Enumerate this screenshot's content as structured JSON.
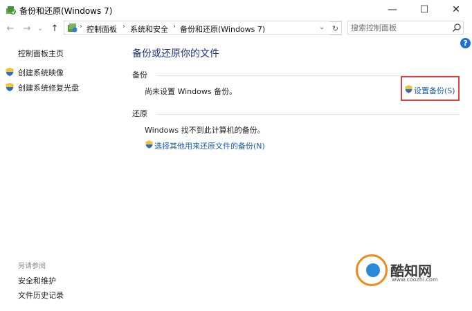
{
  "window": {
    "title": "备份和还原(Windows 7)",
    "minimize_symbol": "—",
    "maximize_symbol": "☐",
    "close_symbol": "✕"
  },
  "nav": {
    "back_symbol": "←",
    "forward_symbol": "→",
    "recent_symbol": "⌄",
    "up_symbol": "↑",
    "breadcrumb": [
      "控制面板",
      "系统和安全",
      "备份和还原(Windows 7)"
    ],
    "breadcrumb_separator": "›",
    "dropdown_symbol": "⌄",
    "refresh_symbol": "↻"
  },
  "search": {
    "placeholder": "搜索控制面板"
  },
  "help": {
    "symbol": "?"
  },
  "sidebar": {
    "home": "控制面板主页",
    "items": [
      {
        "label": "创建系统映像",
        "icon": "shield-icon"
      },
      {
        "label": "创建系统修复光盘",
        "icon": "shield-icon"
      }
    ],
    "see_also_heading": "另请参阅",
    "see_also": [
      "安全和维护",
      "文件历史记录"
    ]
  },
  "main": {
    "title": "备份或还原你的文件",
    "backup": {
      "heading": "备份",
      "status": "尚未设置 Windows 备份。",
      "setup_link": "设置备份(S)"
    },
    "restore": {
      "heading": "还原",
      "status": "Windows 找不到此计算机的备份。",
      "other_link": "选择其他用来还原文件的备份(N)"
    }
  },
  "watermark": {
    "name": "酷知网",
    "url": "www.coozhi.com"
  },
  "colors": {
    "link": "#1a5fb4",
    "title": "#1e3287",
    "highlight": "#d64545"
  }
}
